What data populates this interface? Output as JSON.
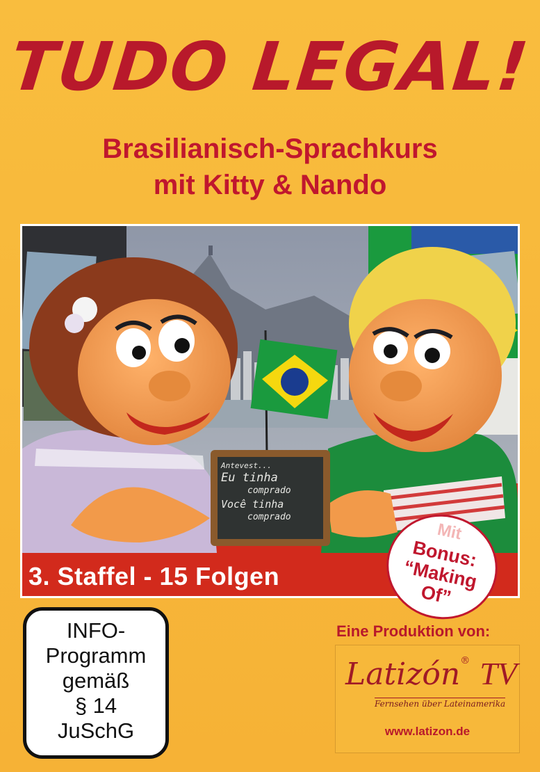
{
  "title": "TUDO LEGAL!",
  "subtitle_line1": "Brasilianisch-Sprachkurs",
  "subtitle_line2": "mit Kitty & Nando",
  "staffel": "3. Staffel - 15 Folgen",
  "bonus": {
    "line1": "Mit",
    "line2": "Bonus:",
    "line3": "“Making",
    "line4": "Of”"
  },
  "chalkboard": {
    "line1": "Antevest...",
    "line2": "Eu tinha",
    "line3": "comprado",
    "line4": "Você tinha",
    "line5": "comprado"
  },
  "info_label": {
    "line1": "INFO-",
    "line2": "Programm",
    "line3": "gemäß",
    "line4": "§ 14",
    "line5": "JuSchG"
  },
  "production": {
    "label": "Eine Produktion von:",
    "logo_name": "Latizón",
    "logo_reg": "®",
    "logo_tv": "TV",
    "logo_tagline": "Fernsehen über Lateinamerika",
    "url": "www.latizon.de"
  },
  "colors": {
    "background": "#f7b83a",
    "title_red": "#b8192b",
    "brazil_green": "#1a9a3e",
    "brazil_yellow": "#f5d80f",
    "brazil_blue": "#1a3c8f"
  }
}
